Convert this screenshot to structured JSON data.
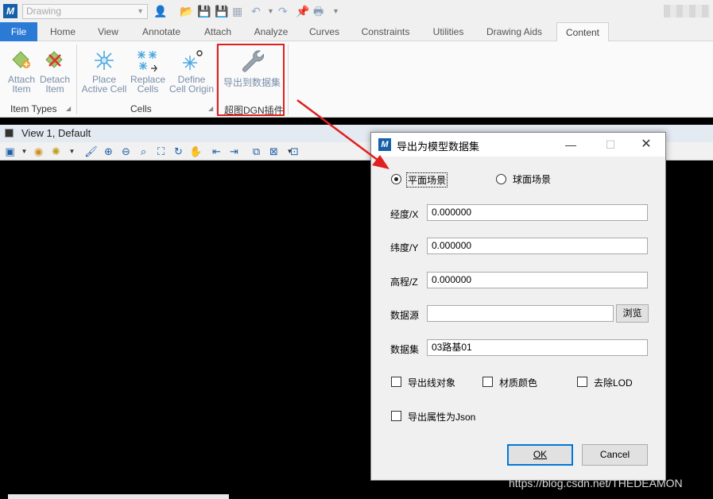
{
  "titlebar": {
    "workspace": "Drawing"
  },
  "tabs": [
    {
      "label": "File"
    },
    {
      "label": "Home"
    },
    {
      "label": "View"
    },
    {
      "label": "Annotate"
    },
    {
      "label": "Attach"
    },
    {
      "label": "Analyze"
    },
    {
      "label": "Curves"
    },
    {
      "label": "Constraints"
    },
    {
      "label": "Utilities"
    },
    {
      "label": "Drawing Aids"
    },
    {
      "label": "Content"
    }
  ],
  "ribbon": {
    "item_types": {
      "label": "Item Types",
      "attach": [
        "Attach",
        "Item"
      ],
      "detach": [
        "Detach",
        "Item"
      ]
    },
    "cells": {
      "label": "Cells",
      "place": [
        "Place",
        "Active Cell"
      ],
      "replace": [
        "Replace",
        "Cells"
      ],
      "define": [
        "Define",
        "Cell Origin"
      ]
    },
    "plugin": {
      "label": "超图DGN插件",
      "export": "导出到数据集"
    }
  },
  "view": {
    "title": "View 1, Default"
  },
  "dialog": {
    "title": "导出为模型数据集",
    "scene_flat": "平面场景",
    "scene_sphere": "球面场景",
    "lon_label": "经度/X",
    "lon_value": "0.000000",
    "lat_label": "纬度/Y",
    "lat_value": "0.000000",
    "alt_label": "高程/Z",
    "alt_value": "0.000000",
    "ds_label": "数据源",
    "ds_value": "",
    "browse": "浏览",
    "dset_label": "数据集",
    "dset_value": "03路基01",
    "opt_lines": "导出线对象",
    "opt_material": "材质颜色",
    "opt_lod": "去除LOD",
    "opt_json": "导出属性为Json",
    "ok": "OK",
    "cancel": "Cancel"
  },
  "watermark": "https://blog.csdn.net/THEDEAMON"
}
